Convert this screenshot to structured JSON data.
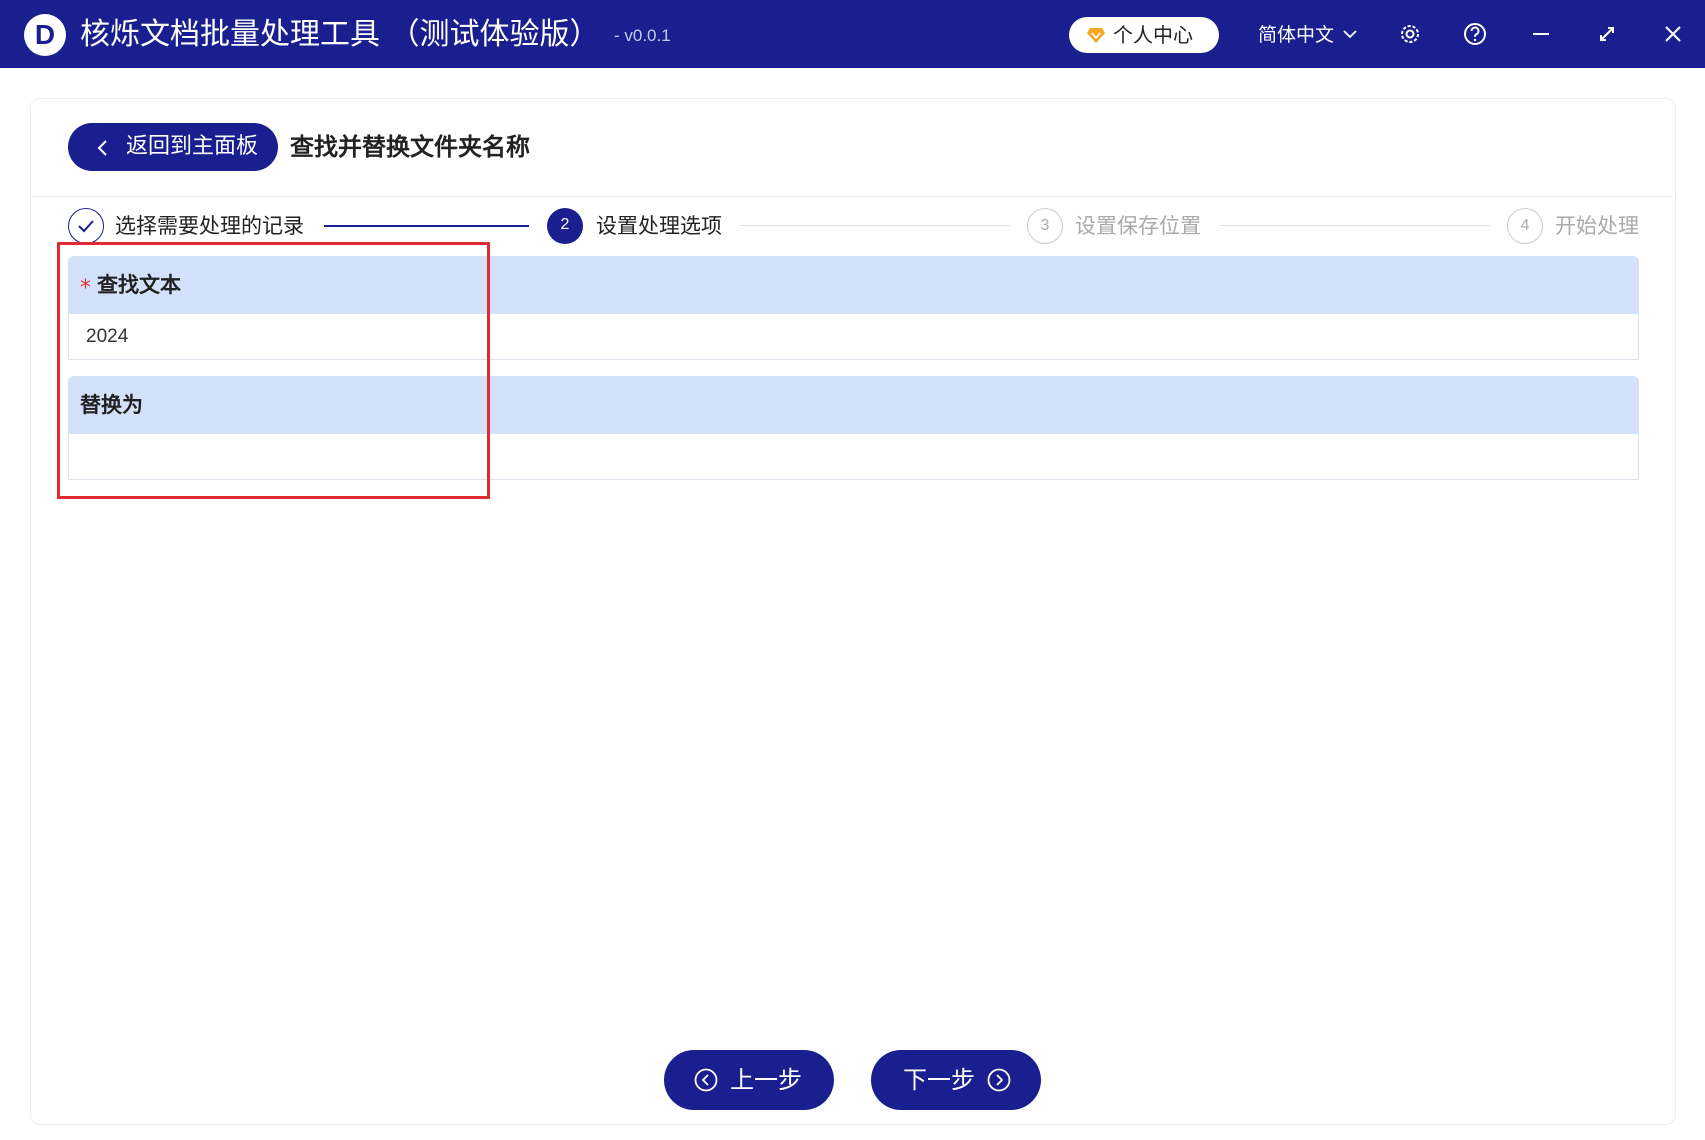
{
  "titlebar": {
    "logo_letter": "D",
    "app_title": "核烁文档批量处理工具 （测试体验版）",
    "version": "- v0.0.1",
    "user_center_label": "个人中心",
    "language": "简体中文"
  },
  "header": {
    "back_label": "返回到主面板",
    "page_title": "查找并替换文件夹名称"
  },
  "steps": [
    {
      "number": "1",
      "label": "选择需要处理的记录",
      "status": "done"
    },
    {
      "number": "2",
      "label": "设置处理选项",
      "status": "active"
    },
    {
      "number": "3",
      "label": "设置保存位置",
      "status": "pending"
    },
    {
      "number": "4",
      "label": "开始处理",
      "status": "pending"
    }
  ],
  "form": {
    "find": {
      "required_mark": "*",
      "label": "查找文本",
      "value": "2024"
    },
    "replace": {
      "label": "替换为",
      "value": ""
    }
  },
  "footer": {
    "prev_label": "上一步",
    "next_label": "下一步"
  },
  "colors": {
    "primary": "#1a1f8f",
    "field_header": "#d3e1fb",
    "highlight": "#e02b33",
    "required": "#e23b3b",
    "step_pending": "#aaaaaa"
  }
}
